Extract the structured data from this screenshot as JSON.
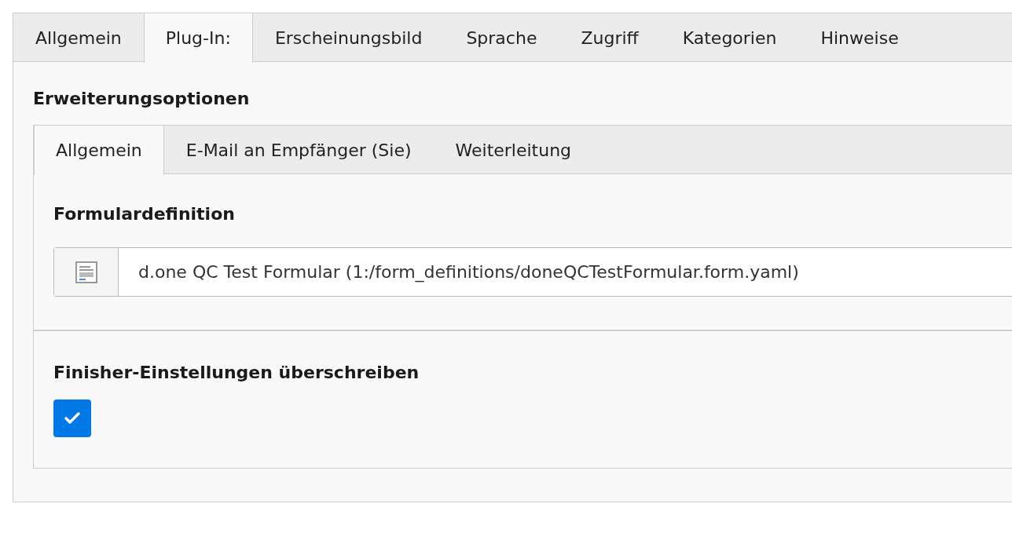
{
  "tabs": [
    {
      "label": "Allgemein",
      "selected": false
    },
    {
      "label": "Plug-In:",
      "selected": true
    },
    {
      "label": "Erscheinungsbild",
      "selected": false
    },
    {
      "label": "Sprache",
      "selected": false
    },
    {
      "label": "Zugriff",
      "selected": false
    },
    {
      "label": "Kategorien",
      "selected": false
    },
    {
      "label": "Hinweise",
      "selected": false
    }
  ],
  "section_title": "Erweiterungsoptionen",
  "sub_tabs": [
    {
      "label": "Allgemein",
      "selected": true
    },
    {
      "label": "E-Mail an Empfänger (Sie)",
      "selected": false
    },
    {
      "label": "Weiterleitung",
      "selected": false
    }
  ],
  "form_definition": {
    "label": "Formulardefinition",
    "value": "d.one QC Test Formular (1:/form_definitions/doneQCTestFormular.form.yaml)"
  },
  "override_finishers": {
    "label": "Finisher-Einstellungen überschreiben",
    "checked": true
  }
}
